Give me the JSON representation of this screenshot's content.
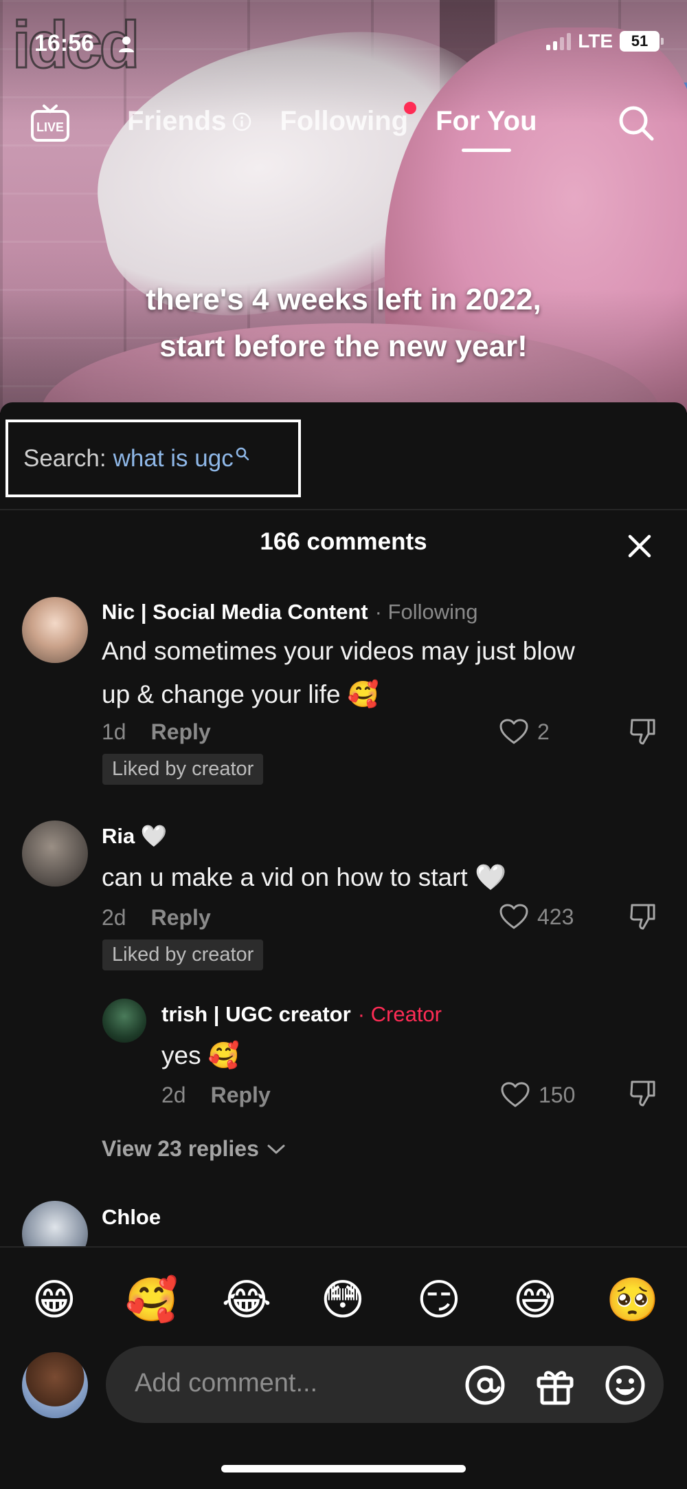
{
  "watermark": "idcd",
  "status_bar": {
    "time": "16:56",
    "network": "LTE",
    "battery": "51"
  },
  "top_nav": {
    "live_label": "LIVE",
    "tabs": [
      {
        "label": "Friends",
        "active": false,
        "icon": "info-icon"
      },
      {
        "label": "Following",
        "active": false,
        "notification_dot": true
      },
      {
        "label": "For You",
        "active": true
      }
    ]
  },
  "video": {
    "caption_line1": "there's 4 weeks left in 2022,",
    "caption_line2": "start before the new year!"
  },
  "search_suggestion": {
    "prefix": "Search:",
    "query": "what is ugc"
  },
  "comments_panel": {
    "count_label": "166 comments",
    "comments": [
      {
        "username": "Nic | Social Media Content",
        "meta": "· Following",
        "text_line1": "And sometimes your videos may just blow",
        "text_line2": "up & change your life 🥰",
        "age": "1d",
        "reply_label": "Reply",
        "likes": "2",
        "badge": "Liked by creator"
      },
      {
        "username": "Ria 🤍",
        "text_line1": "can u make a vid on how to start 🤍",
        "age": "2d",
        "reply_label": "Reply",
        "likes": "423",
        "badge": "Liked by creator",
        "replies": [
          {
            "username": "trish | UGC creator",
            "meta": "· Creator",
            "text": "yes 🥰",
            "age": "2d",
            "reply_label": "Reply",
            "likes": "150"
          }
        ],
        "view_replies_label": "View 23 replies"
      },
      {
        "username": "Chloe"
      }
    ]
  },
  "emoji_bar": [
    "😁",
    "🥰",
    "😂",
    "😳",
    "😏",
    "😅",
    "🥺"
  ],
  "comment_input": {
    "placeholder": "Add comment..."
  },
  "colors": {
    "accent_red": "#fe2c55",
    "search_query_blue": "#8fb8e8",
    "panel_bg": "#121212"
  }
}
